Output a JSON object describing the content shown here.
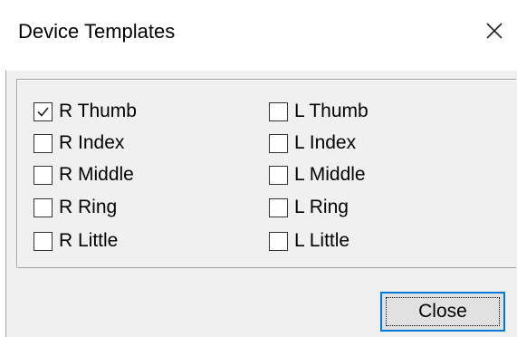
{
  "window": {
    "title": "Device Templates",
    "close_icon": "close-icon"
  },
  "templates": {
    "right": [
      {
        "label": "R Thumb",
        "checked": true
      },
      {
        "label": "R Index",
        "checked": false
      },
      {
        "label": "R Middle",
        "checked": false
      },
      {
        "label": "R Ring",
        "checked": false
      },
      {
        "label": "R Little",
        "checked": false
      }
    ],
    "left": [
      {
        "label": "L Thumb",
        "checked": false
      },
      {
        "label": "L Index",
        "checked": false
      },
      {
        "label": "L Middle",
        "checked": false
      },
      {
        "label": "L Ring",
        "checked": false
      },
      {
        "label": "L Little",
        "checked": false
      }
    ]
  },
  "footer": {
    "close_label": "Close"
  },
  "colors": {
    "focus_border": "#0078d7",
    "panel_background": "#f0f0f0",
    "button_background": "#e1e1e1"
  }
}
